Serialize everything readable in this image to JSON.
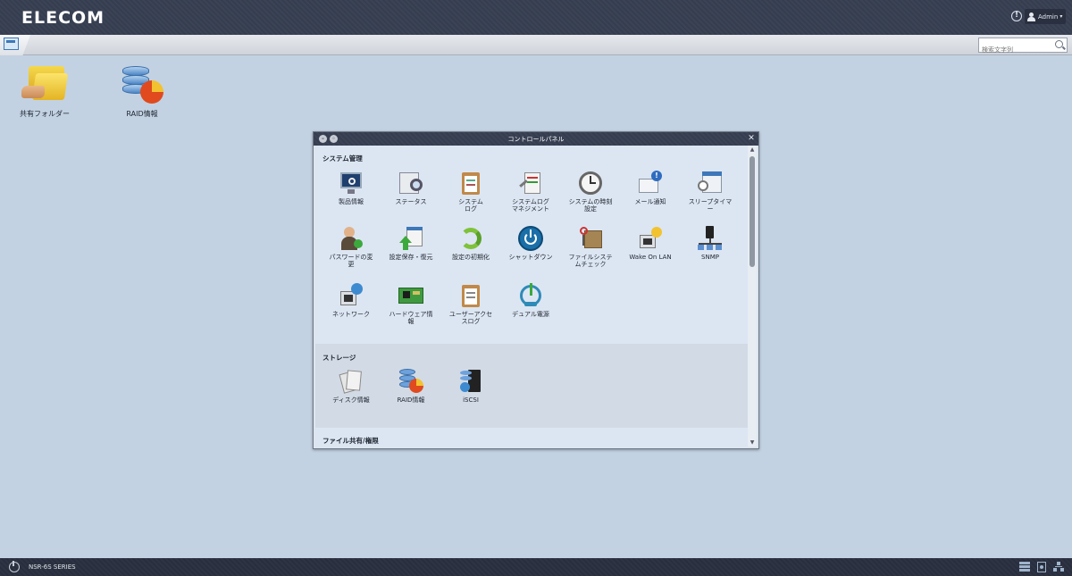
{
  "header": {
    "logo": "ELECOM",
    "info_icon": "!",
    "user_label": "Admin",
    "user_caret": "▾"
  },
  "taskbar": {
    "search_placeholder": "検索文字列"
  },
  "desktop": {
    "icons": [
      {
        "label": "共有フォルダー",
        "icon": "shared-folder-icon"
      },
      {
        "label": "RAID情報",
        "icon": "raid-info-icon"
      }
    ]
  },
  "control_panel": {
    "title": "コントロールパネル",
    "minimize": "–",
    "restore": "◦",
    "close": "✕",
    "sections": {
      "system": {
        "title": "システム管理",
        "items": [
          {
            "label": "製品情報",
            "icon": "product-info-icon"
          },
          {
            "label": "ステータス",
            "icon": "status-icon"
          },
          {
            "label": "システム\nログ",
            "icon": "system-log-icon"
          },
          {
            "label": "システムログ\nマネジメント",
            "icon": "syslog-management-icon"
          },
          {
            "label": "システムの時刻\n設定",
            "icon": "clock-icon"
          },
          {
            "label": "メール通知",
            "icon": "mail-notification-icon"
          },
          {
            "label": "スリープタイマ\nー",
            "icon": "sleep-timer-icon"
          },
          {
            "label": "パスワードの変\n更",
            "icon": "password-change-icon"
          },
          {
            "label": "設定保存・復元",
            "icon": "config-backup-icon"
          },
          {
            "label": "設定の初期化",
            "icon": "reset-icon"
          },
          {
            "label": "シャットダウン",
            "icon": "shutdown-icon"
          },
          {
            "label": "ファイルシステ\nムチェック",
            "icon": "filesystem-check-icon"
          },
          {
            "label": "Wake On LAN",
            "icon": "wake-on-lan-icon"
          },
          {
            "label": "SNMP",
            "icon": "snmp-icon"
          },
          {
            "label": "ネットワーク",
            "icon": "network-icon"
          },
          {
            "label": "ハードウェア情\n報",
            "icon": "hardware-info-icon"
          },
          {
            "label": "ユーザーアクセ\nスログ",
            "icon": "user-access-log-icon"
          },
          {
            "label": "デュアル電源",
            "icon": "dual-power-icon"
          }
        ]
      },
      "storage": {
        "title": "ストレージ",
        "items": [
          {
            "label": "ディスク情報",
            "icon": "disk-info-icon"
          },
          {
            "label": "RAID情報",
            "icon": "raid-info-icon"
          },
          {
            "label": "iSCSI",
            "icon": "iscsi-icon"
          }
        ]
      },
      "fileshare": {
        "title": "ファイル共有/権限"
      }
    }
  },
  "bottombar": {
    "series": "NSR-6S SERIES"
  }
}
